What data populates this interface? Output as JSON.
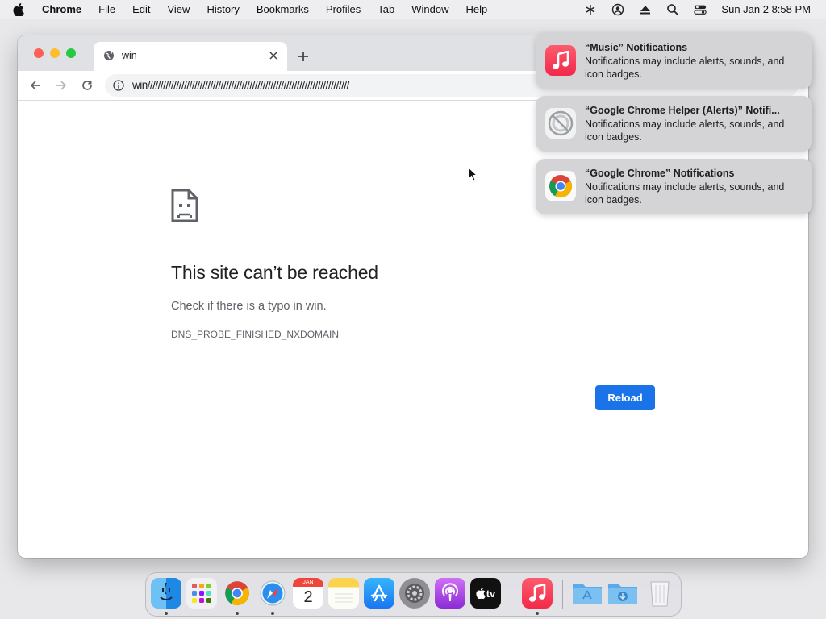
{
  "menubar": {
    "app_name": "Chrome",
    "items": [
      "File",
      "Edit",
      "View",
      "History",
      "Bookmarks",
      "Profiles",
      "Tab",
      "Window",
      "Help"
    ],
    "clock": "Sun Jan 2  8:58 PM"
  },
  "browser": {
    "tab": {
      "title": "win"
    },
    "address": "win/////////////////////////////////////////////////////////////////////////////"
  },
  "error_page": {
    "title": "This site can’t be reached",
    "message": "Check if there is a typo in win.",
    "code": "DNS_PROBE_FINISHED_NXDOMAIN",
    "reload_label": "Reload"
  },
  "notifications": [
    {
      "title": "“Music” Notifications",
      "body": "Notifications may include alerts, sounds, and icon badges.",
      "icon": "music-app-icon"
    },
    {
      "title": "“Google Chrome Helper (Alerts)” Notifi...",
      "body": "Notifications may include alerts, sounds, and icon badges.",
      "icon": "chrome-helper-icon"
    },
    {
      "title": "“Google Chrome” Notifications",
      "body": "Notifications may include alerts, sounds, and icon badges.",
      "icon": "chrome-icon"
    }
  ],
  "dock": {
    "apps": [
      "Finder",
      "Launchpad",
      "Google Chrome",
      "Safari",
      "Calendar",
      "Notes",
      "App Store",
      "System Preferences",
      "Podcasts",
      "TV",
      "Music",
      "Applications",
      "Downloads",
      "Trash"
    ],
    "calendar": {
      "month": "JAN",
      "day": "2"
    },
    "tv_label": "tv"
  },
  "colors": {
    "accent": "#1a73e8",
    "menubar": "#eeeef0",
    "tabstrip": "#dfe1e5"
  }
}
